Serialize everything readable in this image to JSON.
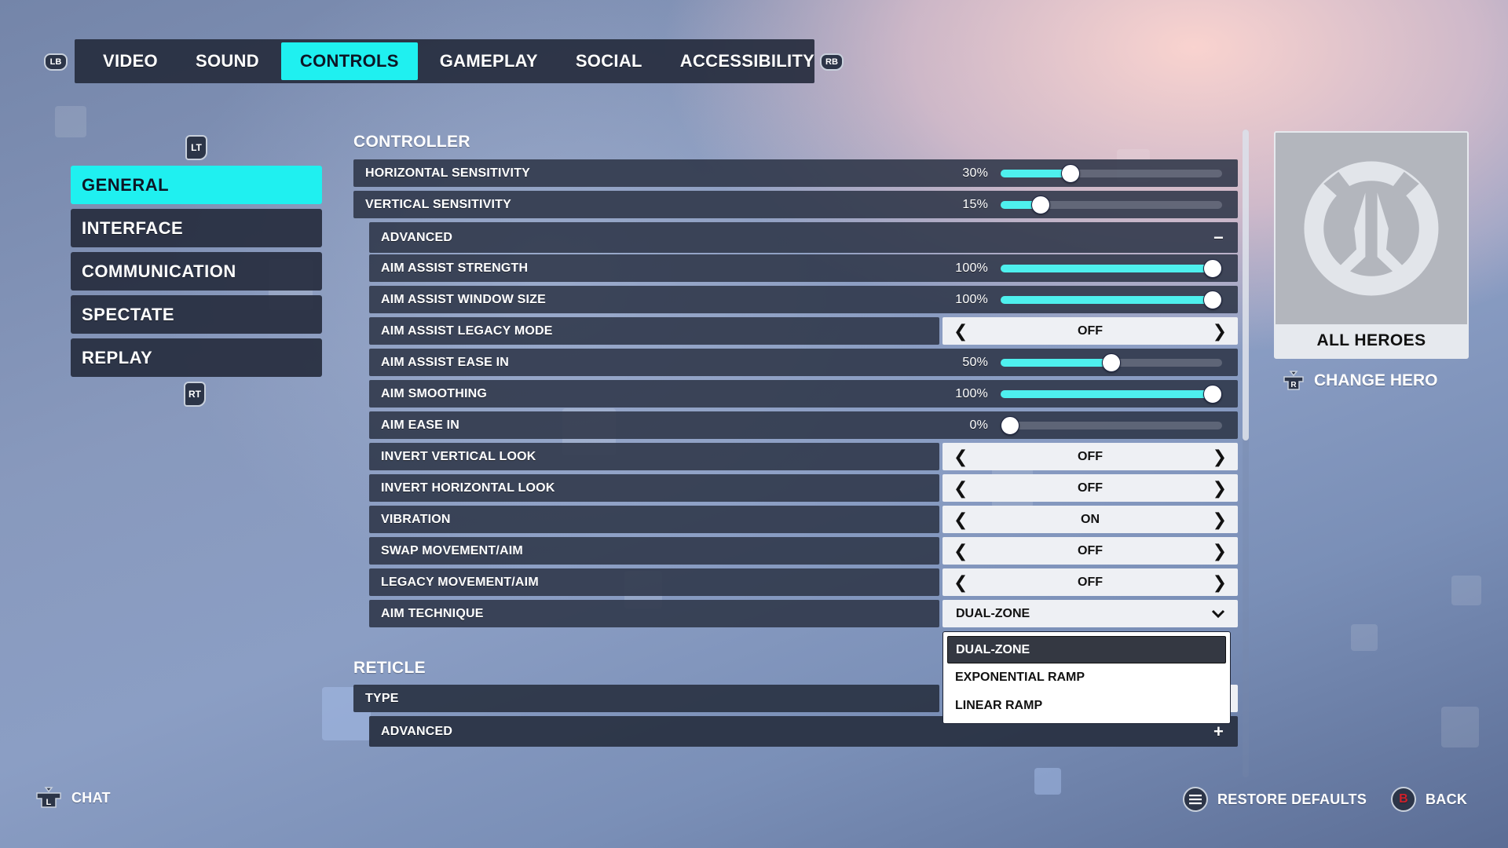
{
  "tabs": {
    "left_bumper": "LB",
    "right_bumper": "RB",
    "items": [
      {
        "label": "VIDEO",
        "active": false
      },
      {
        "label": "SOUND",
        "active": false
      },
      {
        "label": "CONTROLS",
        "active": true
      },
      {
        "label": "GAMEPLAY",
        "active": false
      },
      {
        "label": "SOCIAL",
        "active": false
      },
      {
        "label": "ACCESSIBILITY",
        "active": false
      }
    ]
  },
  "sidebar": {
    "top_trigger": "LT",
    "bottom_trigger": "RT",
    "items": [
      {
        "label": "GENERAL",
        "active": true
      },
      {
        "label": "INTERFACE",
        "active": false
      },
      {
        "label": "COMMUNICATION",
        "active": false
      },
      {
        "label": "SPECTATE",
        "active": false
      },
      {
        "label": "REPLAY",
        "active": false
      }
    ]
  },
  "controller": {
    "title": "CONTROLLER",
    "horizontal_sensitivity": {
      "label": "HORIZONTAL SENSITIVITY",
      "value_text": "30%",
      "value": 30
    },
    "vertical_sensitivity": {
      "label": "VERTICAL SENSITIVITY",
      "value_text": "15%",
      "value": 15
    },
    "advanced": {
      "label": "ADVANCED",
      "expanded_sign": "−"
    },
    "aim_assist_strength": {
      "label": "AIM ASSIST STRENGTH",
      "value_text": "100%",
      "value": 100
    },
    "aim_assist_window_size": {
      "label": "AIM ASSIST WINDOW SIZE",
      "value_text": "100%",
      "value": 100
    },
    "aim_assist_legacy_mode": {
      "label": "AIM ASSIST LEGACY MODE",
      "value": "OFF"
    },
    "aim_assist_ease_in": {
      "label": "AIM ASSIST EASE IN",
      "value_text": "50%",
      "value": 50
    },
    "aim_smoothing": {
      "label": "AIM SMOOTHING",
      "value_text": "100%",
      "value": 100
    },
    "aim_ease_in": {
      "label": "AIM EASE IN",
      "value_text": "0%",
      "value": 0
    },
    "invert_vertical_look": {
      "label": "INVERT VERTICAL LOOK",
      "value": "OFF"
    },
    "invert_horizontal_look": {
      "label": "INVERT HORIZONTAL LOOK",
      "value": "OFF"
    },
    "vibration": {
      "label": "VIBRATION",
      "value": "ON"
    },
    "swap_movement_aim": {
      "label": "SWAP MOVEMENT/AIM",
      "value": "OFF"
    },
    "legacy_movement_aim": {
      "label": "LEGACY MOVEMENT/AIM",
      "value": "OFF"
    },
    "aim_technique": {
      "label": "AIM TECHNIQUE",
      "value": "DUAL-ZONE",
      "options": [
        "DUAL-ZONE",
        "EXPONENTIAL RAMP",
        "LINEAR RAMP"
      ],
      "selected_index": 0
    }
  },
  "reticle": {
    "title": "RETICLE",
    "type": {
      "label": "TYPE"
    },
    "advanced": {
      "label": "ADVANCED",
      "collapsed_sign": "+"
    }
  },
  "hero": {
    "name": "ALL HEROES",
    "change_label": "CHANGE HERO",
    "change_button_glyph": "R"
  },
  "footer": {
    "chat_label": "CHAT",
    "chat_glyph": "L",
    "restore_label": "RESTORE DEFAULTS",
    "back_label": "BACK",
    "back_glyph": "B"
  },
  "colors": {
    "accent": "#1ff0f0",
    "slider_fill": "#4ef0ee",
    "back_button_glyph": "#d0202a"
  },
  "scroll": {
    "position": 0,
    "visible_fraction": 0.48
  }
}
